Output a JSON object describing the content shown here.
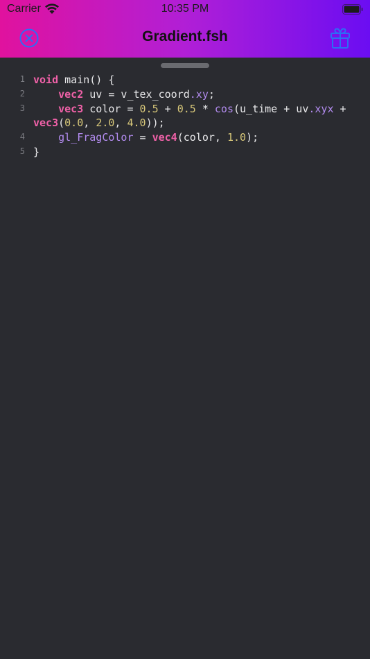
{
  "status_bar": {
    "carrier": "Carrier",
    "time": "10:35 PM"
  },
  "nav": {
    "title": "Gradient.fsh",
    "close_icon": "close-circle-icon",
    "gift_icon": "gift-icon"
  },
  "colors": {
    "gradient_start": "#e0129e",
    "gradient_end": "#6b0df2",
    "editor_bg": "#2a2b30",
    "keyword": "#f061a8",
    "number": "#d8c87a",
    "builtin": "#b38cf0",
    "plain": "#e8e8ea",
    "line_number": "#7c7d83",
    "nav_icon": "#2b6ef5"
  },
  "editor": {
    "lines": [
      {
        "number": "1",
        "tokens": [
          {
            "text": "void",
            "kind": "kw"
          },
          {
            "text": " main() {",
            "kind": "pl"
          }
        ]
      },
      {
        "number": "2",
        "tokens": [
          {
            "text": "    ",
            "kind": "pl"
          },
          {
            "text": "vec2",
            "kind": "kw"
          },
          {
            "text": " uv = v_tex_coord",
            "kind": "pl"
          },
          {
            "text": ".xy",
            "kind": "fn"
          },
          {
            "text": ";",
            "kind": "pl"
          }
        ]
      },
      {
        "number": "3",
        "tokens": [
          {
            "text": "    ",
            "kind": "pl"
          },
          {
            "text": "vec3",
            "kind": "kw"
          },
          {
            "text": " color = ",
            "kind": "pl"
          },
          {
            "text": "0.5",
            "kind": "num"
          },
          {
            "text": " + ",
            "kind": "pl"
          },
          {
            "text": "0.5",
            "kind": "num"
          },
          {
            "text": " * ",
            "kind": "pl"
          },
          {
            "text": "cos",
            "kind": "fn"
          },
          {
            "text": "(u_time + uv",
            "kind": "pl"
          },
          {
            "text": ".xyx",
            "kind": "fn"
          },
          {
            "text": " +",
            "kind": "pl"
          }
        ]
      },
      {
        "number": "",
        "tokens": [
          {
            "text": "vec3",
            "kind": "kw"
          },
          {
            "text": "(",
            "kind": "pl"
          },
          {
            "text": "0.0",
            "kind": "num"
          },
          {
            "text": ", ",
            "kind": "pl"
          },
          {
            "text": "2.0",
            "kind": "num"
          },
          {
            "text": ", ",
            "kind": "pl"
          },
          {
            "text": "4.0",
            "kind": "num"
          },
          {
            "text": "));",
            "kind": "pl"
          }
        ]
      },
      {
        "number": "4",
        "tokens": [
          {
            "text": "    ",
            "kind": "pl"
          },
          {
            "text": "gl_FragColor",
            "kind": "fn"
          },
          {
            "text": " = ",
            "kind": "pl"
          },
          {
            "text": "vec4",
            "kind": "kw"
          },
          {
            "text": "(color, ",
            "kind": "pl"
          },
          {
            "text": "1.0",
            "kind": "num"
          },
          {
            "text": ");",
            "kind": "pl"
          }
        ]
      },
      {
        "number": "5",
        "tokens": [
          {
            "text": "}",
            "kind": "pl"
          }
        ]
      }
    ]
  }
}
